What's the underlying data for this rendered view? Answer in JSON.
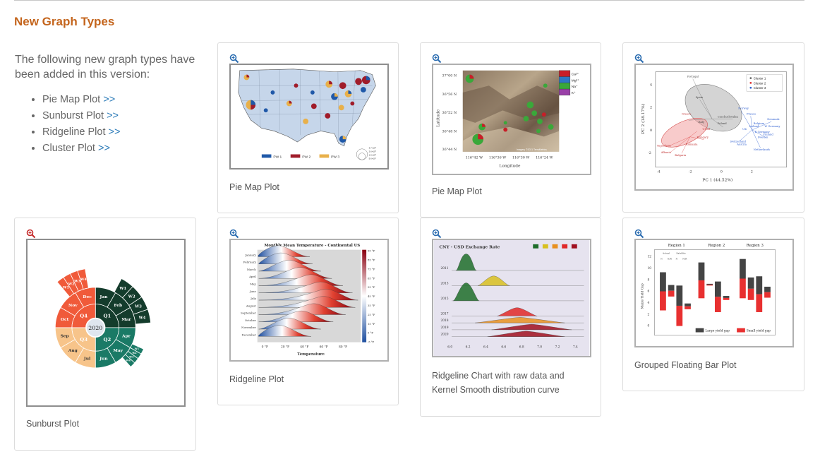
{
  "section": {
    "title": "New Graph Types",
    "intro": "The following new graph types have been added in this version:",
    "features": [
      {
        "label": "Pie Map Plot",
        "link": ">>"
      },
      {
        "label": "Sunburst Plot",
        "link": ">>"
      },
      {
        "label": "Ridgeline Plot",
        "link": ">>"
      },
      {
        "label": "Cluster Plot",
        "link": ">>"
      }
    ]
  },
  "cards": [
    {
      "caption": "Pie Map Plot",
      "legend": [
        "PW 1",
        "PW 2",
        "PW 3"
      ],
      "size_legend": [
        "3.7×10⁵",
        "2.6×10⁵",
        "1.5×10⁵",
        "5.6×10⁴"
      ]
    },
    {
      "caption": "Pie Map Plot",
      "ylabel": "Latitude",
      "xlabel": "Longitude",
      "yticks": [
        "37°00 N",
        "36°56 N",
        "36°52 N",
        "36°48 N",
        "36°44 N"
      ],
      "xticks": [
        "116°42 W",
        "116°36 W",
        "116°30 W",
        "116°24 W"
      ],
      "legend": [
        "Ca²⁺",
        "Mg²⁺",
        "Na⁺",
        "K⁺"
      ],
      "credit": "Imagery ©2021 TerraMetrics"
    },
    {
      "caption": "",
      "xlabel": "PC 1 (44.52%)",
      "ylabel": "PC 2 (18.17%)",
      "legend": [
        "Cluster 1",
        "Cluster 2",
        "Cluster 3"
      ],
      "xticks": [
        "-4",
        "-2",
        "0",
        "2"
      ],
      "yticks": [
        "4",
        "2",
        "0",
        "-2"
      ],
      "labels_gray": [
        "Portugal",
        "Spain",
        "Greece",
        "Italy",
        "Poland"
      ],
      "labels_red": [
        "Yugoslavia",
        "Albania",
        "Bulgaria",
        "Romania",
        "Hungary",
        "USSR"
      ],
      "labels_blue": [
        "Norway",
        "France",
        "Denmark",
        "W Germany",
        "E Germany",
        "Finland",
        "Sweden",
        "Ireland",
        "Switzerland",
        "Austria",
        "Netherlands",
        "Czechoslovakia",
        "UK",
        "Belgium"
      ]
    },
    {
      "caption": "Sunburst Plot",
      "center": "2020",
      "quarters": [
        "Q1",
        "Q2",
        "Q3",
        "Q4"
      ],
      "months": [
        "Jan",
        "Feb",
        "Mar",
        "Apr",
        "May",
        "Jun",
        "Jul",
        "Aug",
        "Sep",
        "Oct",
        "Nov",
        "Dec"
      ],
      "weeks": [
        "W1",
        "W2",
        "W3",
        "W4"
      ]
    },
    {
      "caption": "Ridgeline Plot",
      "title": "Monthly Mean Temperature - Continental US",
      "xlabel": "Temperature",
      "months": [
        "January",
        "February",
        "March",
        "April",
        "May",
        "June",
        "July",
        "August",
        "September",
        "October",
        "November",
        "December"
      ],
      "xticks": [
        "0 °F",
        "20 °F",
        "40 °F",
        "60 °F",
        "80 °F"
      ],
      "colorbar": [
        "95 °F",
        "85 °F",
        "75 °F",
        "65 °F",
        "55 °F",
        "45 °F",
        "35 °F",
        "25 °F",
        "15 °F",
        "5 °F",
        "-5 °F"
      ]
    },
    {
      "caption": "Ridgeline Chart with raw data and Kernel Smooth distribution curve",
      "title": "CNY - USD Exchange Rate",
      "years": [
        "2011",
        "2013",
        "2015",
        "2017",
        "2018",
        "2019",
        "2020"
      ],
      "xticks": [
        "6.0",
        "6.2",
        "6.4",
        "6.6",
        "6.8",
        "7.0",
        "7.2",
        "7.4"
      ]
    },
    {
      "caption": "Grouped Floating Bar Plot",
      "regions": [
        "Region 1",
        "Region 2",
        "Region 3"
      ],
      "ylabel": "Maize Yield Gap",
      "legend": [
        "Large yield gap",
        "Small yield gap"
      ],
      "yticks": [
        "12",
        "10",
        "8",
        "6",
        "4",
        "2",
        "0"
      ],
      "sublabels": [
        "Actual",
        "Satellite",
        "N",
        "N/R",
        "N",
        "N/R"
      ],
      "value_labels": [
        "9.2",
        "2.6",
        "7",
        "5",
        "6.9",
        "-0.1",
        "3.8",
        "2.8",
        "10.9",
        "4.7",
        "7.2",
        "6.9",
        "7.6",
        "2.3",
        "5.1",
        "11.5",
        "4.7",
        "8.3",
        "8.2",
        "8.5",
        "2.3",
        "6.7",
        "4.8"
      ]
    }
  ]
}
